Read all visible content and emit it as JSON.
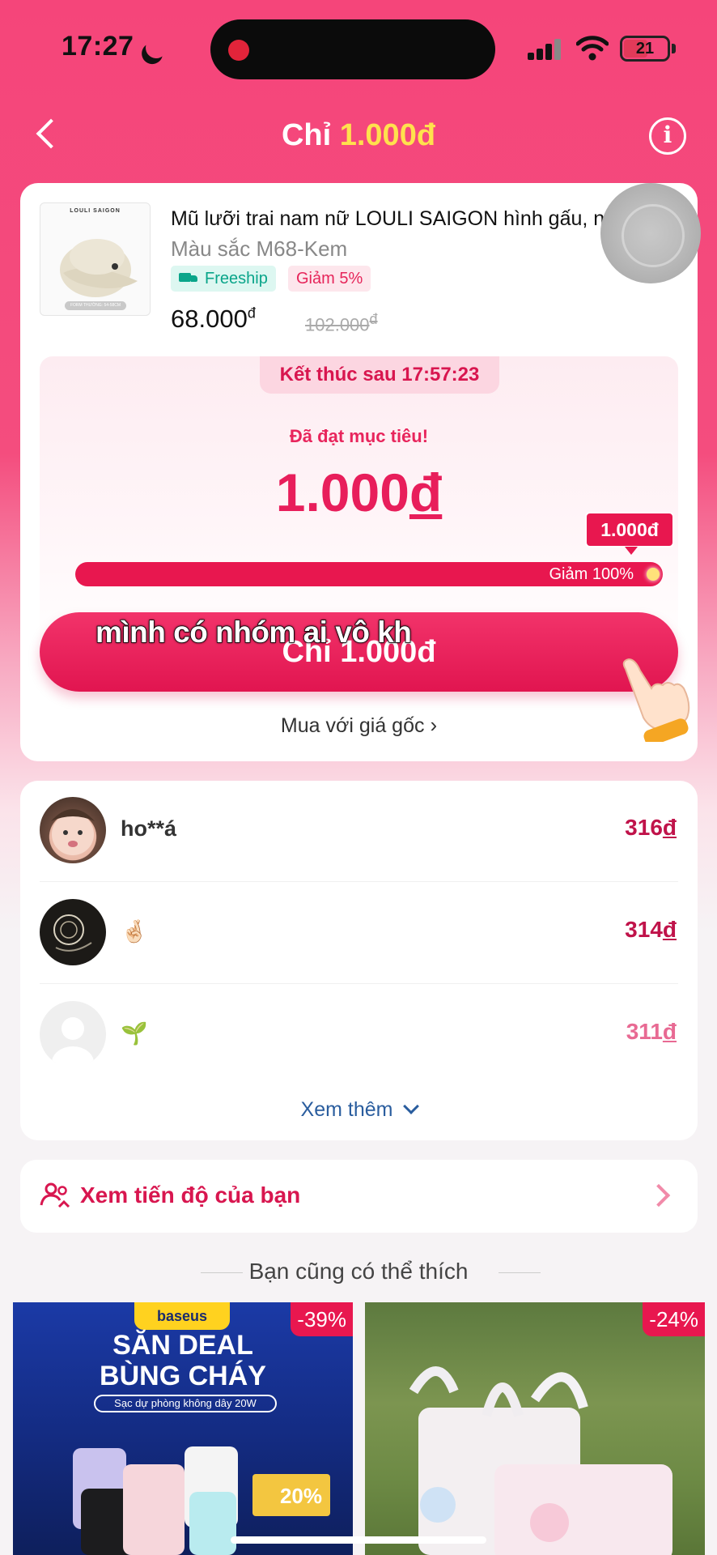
{
  "status_bar": {
    "time": "17:27",
    "battery": "21"
  },
  "header": {
    "title_prefix": "Chỉ ",
    "title_price": "1.000đ"
  },
  "product": {
    "brand": "LOULI SAIGON",
    "thumb_tag": "FORM THƯỜNG: 54-58CM",
    "name": "Mũ lưỡi trai nam nữ LOULI SAIGON hình gấu, n...",
    "variant": "Màu sắc  M68-Kem",
    "badge_freeship": "Freeship",
    "badge_discount": "Giảm 5%",
    "price": "68.000",
    "price_currency": "đ",
    "old_price": "102.000",
    "old_currency": "đ"
  },
  "goal": {
    "countdown": "Kết thúc sau 17:57:23",
    "reached_text": "Đã đạt mục tiêu!",
    "amount": "1.000",
    "amount_currency": "đ",
    "bubble": "1.000đ",
    "progress_label": "Giảm 100%",
    "progress_fraction": 1.0
  },
  "cta": {
    "label": "Chỉ 1.000đ",
    "buy_original": "Mua với giá gốc"
  },
  "caption": "mình có nhóm ai vô kh",
  "participants": [
    {
      "name": "ho**á",
      "amount": "316",
      "currency": "đ"
    },
    {
      "name": "🤞🏻",
      "amount": "314",
      "currency": "đ"
    },
    {
      "name": "🌱",
      "amount": "311",
      "currency": "đ"
    }
  ],
  "see_more": "Xem thêm",
  "progress_link": "Xem tiến độ của bạn",
  "recommend_title": "Bạn cũng có thể thích",
  "recommendations": [
    {
      "discount": "-39%",
      "brand": "baseus",
      "line1": "SĂN DEAL",
      "line2": "BÙNG CHÁY",
      "line3": "Sạc dự phòng không dây 20W",
      "voucher": "20%"
    },
    {
      "discount": "-24%"
    }
  ],
  "colors": {
    "primary": "#e8174f",
    "header_bg": "#f5457a",
    "price_highlight": "#ffe14d",
    "link_blue": "#2a5d9e"
  }
}
